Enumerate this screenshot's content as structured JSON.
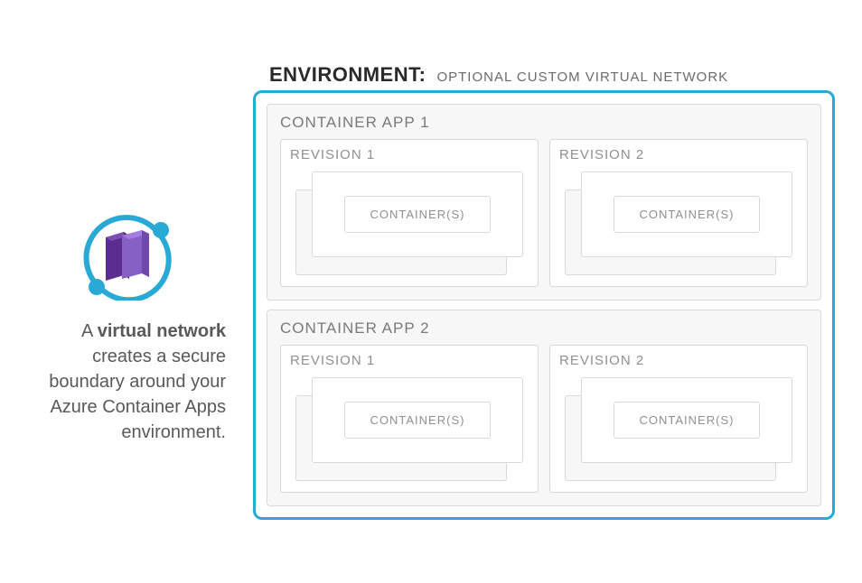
{
  "description": {
    "bold": "virtual network",
    "prefix": "A ",
    "rest": " creates a secure boundary around your Azure Container Apps environment."
  },
  "environment": {
    "title": "ENVIRONMENT:",
    "subtitle": "OPTIONAL CUSTOM VIRTUAL NETWORK",
    "apps": [
      {
        "title": "CONTAINER APP 1",
        "revisions": [
          {
            "title": "REVISION 1",
            "container_label": "CONTAINER(S)"
          },
          {
            "title": "REVISION 2",
            "container_label": "CONTAINER(S)"
          }
        ]
      },
      {
        "title": "CONTAINER APP 2",
        "revisions": [
          {
            "title": "REVISION 1",
            "container_label": "CONTAINER(S)"
          },
          {
            "title": "REVISION 2",
            "container_label": "CONTAINER(S)"
          }
        ]
      }
    ]
  },
  "colors": {
    "accent": "#29a9d6",
    "purple_dark": "#5b2d90",
    "purple_mid": "#8661c5",
    "teal": "#29a9d6"
  }
}
